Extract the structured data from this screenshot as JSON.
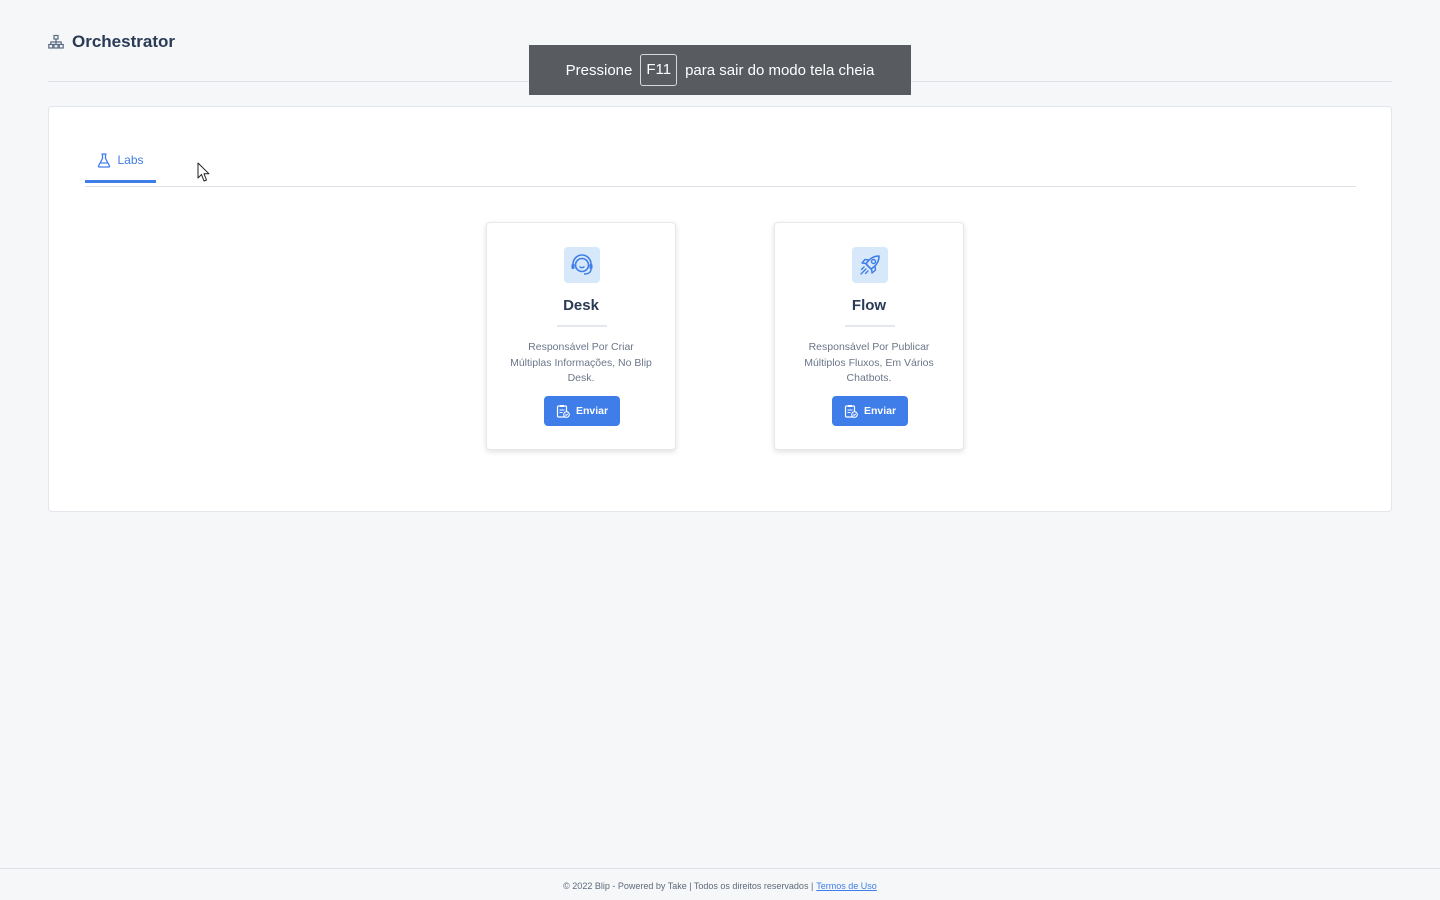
{
  "header": {
    "title": "Orchestrator",
    "icon": "sitemap-icon"
  },
  "fullscreen_toast": {
    "prefix": "Pressione",
    "key": "F11",
    "suffix": "para sair do modo tela cheia"
  },
  "tabs": [
    {
      "label": "Labs",
      "icon": "flask-icon",
      "active": true
    }
  ],
  "features": [
    {
      "title": "Desk",
      "icon": "headset-icon",
      "description": "Responsável Por Criar Múltiplas Informações, No Blip Desk.",
      "button_label": "Enviar"
    },
    {
      "title": "Flow",
      "icon": "rocket-icon",
      "description": "Responsável Por Publicar Múltiplos Fluxos, Em Vários Chatbots.",
      "button_label": "Enviar"
    }
  ],
  "footer": {
    "text": "© 2022 Blip - Powered by Take | Todos os direitos reservados |",
    "link_label": "Termos de Uso"
  },
  "colors": {
    "accent": "#3f7de8",
    "background": "#f5f7f9",
    "toast_bg": "#585c61",
    "icon_bg": "#d6e8fa"
  }
}
